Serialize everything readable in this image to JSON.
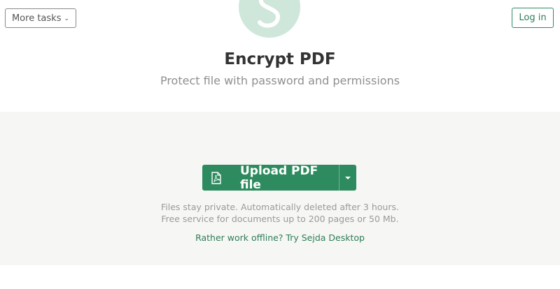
{
  "header": {
    "more_tasks_label": "More tasks",
    "login_label": "Log in"
  },
  "page": {
    "title": "Encrypt PDF",
    "subtitle": "Protect file with password and permissions"
  },
  "upload": {
    "button_label": "Upload PDF file",
    "icon": "pdf-file-icon",
    "dropdown_icon": "caret-down-icon",
    "note_line1": "Files stay private. Automatically deleted after 3 hours.",
    "note_line2": "Free service for documents up to 200 pages or 50 Mb.",
    "offline_link": "Rather work offline? Try Sejda Desktop"
  },
  "colors": {
    "accent": "#2e8b5f",
    "logo_bg": "#cfe7db",
    "upload_area_bg": "#f6f6f4"
  }
}
